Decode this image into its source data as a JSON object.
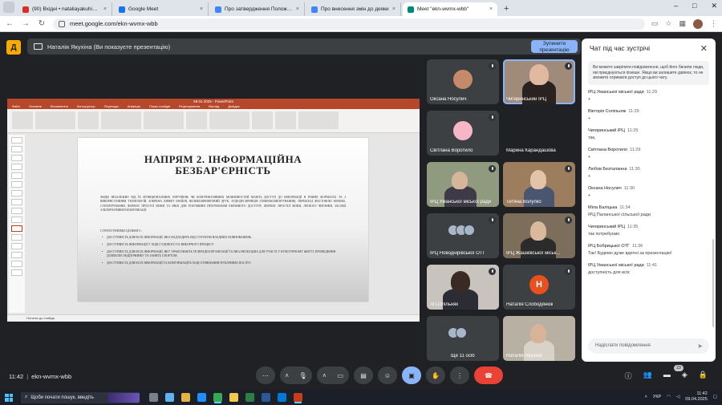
{
  "browser": {
    "tabs": [
      {
        "title": "(90) Вхідні • nataliayakuhina9",
        "color": "#d93025",
        "active": false
      },
      {
        "title": "Google Meet",
        "color": "#1a73e8",
        "active": false
      },
      {
        "title": "Про затвердження Положен",
        "color": "#4285f4",
        "active": false
      },
      {
        "title": "Про внесення змін до деяки",
        "color": "#4285f4",
        "active": false
      },
      {
        "title": "Meet \"ekn-wvmx-wbb\"",
        "color": "#00897b",
        "active": true
      }
    ],
    "new_tab": "+",
    "url": "meet.google.com/ekn-wvmx-wbb"
  },
  "meet": {
    "presenter_banner": "Наталія Якухіна (Ви показуєте презентацію)",
    "stop_button": "Зупинити презентацію",
    "time": "11:42",
    "meeting_code": "ekn-wvmx-wbb",
    "participants_badge": "23"
  },
  "presentation": {
    "app_title": "69.04.2025 - PowerPoint",
    "menu": [
      "Файл",
      "Основне",
      "Вставлення",
      "Конструктор",
      "Переходи",
      "Анімація",
      "Показ слайдів",
      "Рецензування",
      "Вигляд",
      "Довідка"
    ],
    "slide_title_line1": "НАПРЯМ 2. ІНФОРМАЦІЙНА",
    "slide_title_line2": "БЕЗБАР'ЄРНІСТЬ",
    "paragraph": "ЛЮДИ НЕЗАЛЕЖНО ВІД ЇХ ФУНКЦІОНАЛЬНИХ ПОРУШЕНЬ ЧИ КОМУНІКАТИВНИХ МОЖЛИВОСТЕЙ МАЮТЬ ДОСТУП ДО ІНФОРМАЦІЇ В РІЗНИХ ФОРМАТАХ ТА З ВИКОРИСТАННЯМ ТЕХНОЛОГІЙ, ЗОКРЕМА ШРИФТ БРАЙЛЯ, ВЕЛИКОШРИФТОВИЙ ДРУК, АУДІОДЕСКРИПЦІЯ (ТИФЛОКОМЕНТУВАННЯ), ПЕРЕКЛАД ЖЕСТОВОЮ МОВОЮ, СУБТИТРУВАННЯ, ФОРМАТ ПРОСТОЇ МОВИ ТА ІНШІ ДЛЯ РОЗУМІННЯ ПРОГРАМАМИ ЕКРАННОГО ДОСТУПУ, ФОРМАТ ПРОСТОЇ МОВИ, ЛЕГКОГО ЧИТАННЯ, ЗАСОБИ АЛЬТЕРНАТИВНОЇ КОМУНІКАЦІЇ.",
    "goals_label": "СТРАТЕГІЧНИМИ ЦІЛЯМИ Є:",
    "goals": [
      "ДОСТУПНІСТЬ ДЛЯ ВСІХ ІНФОРМАЦІЇ, ЯКА НАДХОДИТЬ ВІД СУБ'ЄКТІВ ВЛАДНИХ ПОВНОВАЖЕНЬ.",
      "ДОСТУПНІСТЬ ІНФОРМАЦІЇ У ХОДІ СУДОВОГО ТА ВИБОРЧОГО ПРОЦЕСУ.",
      "ДОСТУПНІСТЬ ДЛЯ ВСІХ ІНФОРМАЦІЇ, ЯКУ ТРАНСЛЮЮТЬ ТЕЛЕРАДІООРГАНІЗАЦІЇ ТА ЯКА НЕОБХІДНА ДЛЯ УЧАСТІ У КУЛЬТУРНОМУ ЖИТТІ, ПРОВЕДЕННЯ ДОЗВІЛЛЯ І ВІДПОЧИНКУ ТА ЗАНЯТЬ СПОРТОМ.",
      "ДОСТУПНІСТЬ ДЛЯ ВСІХ ІНФОРМАЦІЇ ТА КОМУНІКАЦІЇ В ХОДІ ОТРИМАННЯ ПУБЛІЧНИХ ПОСЛУГ."
    ],
    "status": "Нотатки до слайда"
  },
  "participants": [
    {
      "name": "Оксана Носулич",
      "kind": "avatar",
      "color": "#c58a6a",
      "speaking": false
    },
    {
      "name": "Чигиринський ІРЦ",
      "kind": "video",
      "color": "#b59a86",
      "speaking": true
    },
    {
      "name": "Світлана Воротило",
      "kind": "avatar",
      "color": "#f7b6c7",
      "speaking": false
    },
    {
      "name": "Марина Карандашова",
      "kind": "empty",
      "color": "#3c4043",
      "speaking": false
    },
    {
      "name": "ІРЦ Уманської міської ради",
      "kind": "video",
      "color": "#8f9a7e",
      "speaking": false
    },
    {
      "name": "Тетяна Волупко",
      "kind": "video",
      "color": "#9c7e5e",
      "speaking": false
    },
    {
      "name": "ІРЦ Новоднірівської ОТГ",
      "kind": "group",
      "color": "#6a7a96",
      "speaking": false
    },
    {
      "name": "ІРЦ Жашківської міськ...",
      "kind": "video",
      "color": "#7d6e5c",
      "speaking": false
    },
    {
      "name": "Лі Сопільняк",
      "kind": "video",
      "color": "#c9c3bd",
      "speaking": false
    },
    {
      "name": "Наталія Слободянюк",
      "kind": "letter",
      "letter": "Н",
      "color": "#e8501d",
      "speaking": false
    },
    {
      "name": "Ще 11 осіб",
      "kind": "more",
      "color": "#3c4043",
      "speaking": false
    },
    {
      "name": "Наталія Якухіна",
      "kind": "video",
      "color": "#b9b0a4",
      "speaking": false
    }
  ],
  "chat": {
    "title": "Чат під час зустрічі",
    "notice": "Ви можете закріпити повідомлення, щоб його бачили люди, які приєднуються пізніше. Якщо ви залишите дзвінок, то не зможете отримати доступ до цього чату.",
    "messages": [
      {
        "from": "ІРЦ Уманської міської ради",
        "time": "11:29",
        "text": "+"
      },
      {
        "from": "Вікторія Сопільняк",
        "time": "11:29",
        "text": "+"
      },
      {
        "from": "Чигиринський ІРЦ",
        "time": "11:29",
        "text": "так,"
      },
      {
        "from": "Світлана Воротило",
        "time": "11:29",
        "text": "+"
      },
      {
        "from": "Любов Безталанна",
        "time": "11:30",
        "text": "+"
      },
      {
        "from": "Оксана Носулич",
        "time": "11:30",
        "text": "+"
      },
      {
        "from": "Міла Баліцька",
        "time": "11:34",
        "text": "ІРЦ Паланської сільської ради"
      },
      {
        "from": "Чигиринський ІРЦ",
        "time": "11:35",
        "text": "так потребуємо"
      },
      {
        "from": "ІРЦ Бобрицької ОТГ",
        "time": "11:36",
        "text": "Так! Будемо дуже вдячні за презентацію!"
      },
      {
        "from": "ІРЦ Уманської міської ради",
        "time": "11:41",
        "text": "доступність для всіх"
      }
    ],
    "input_placeholder": "Надіслати повідомлення"
  },
  "taskbar": {
    "search_placeholder": "Щоби почати пошук, введіть",
    "lang": "УКР",
    "time": "11:42",
    "date": "09.04.2025"
  }
}
